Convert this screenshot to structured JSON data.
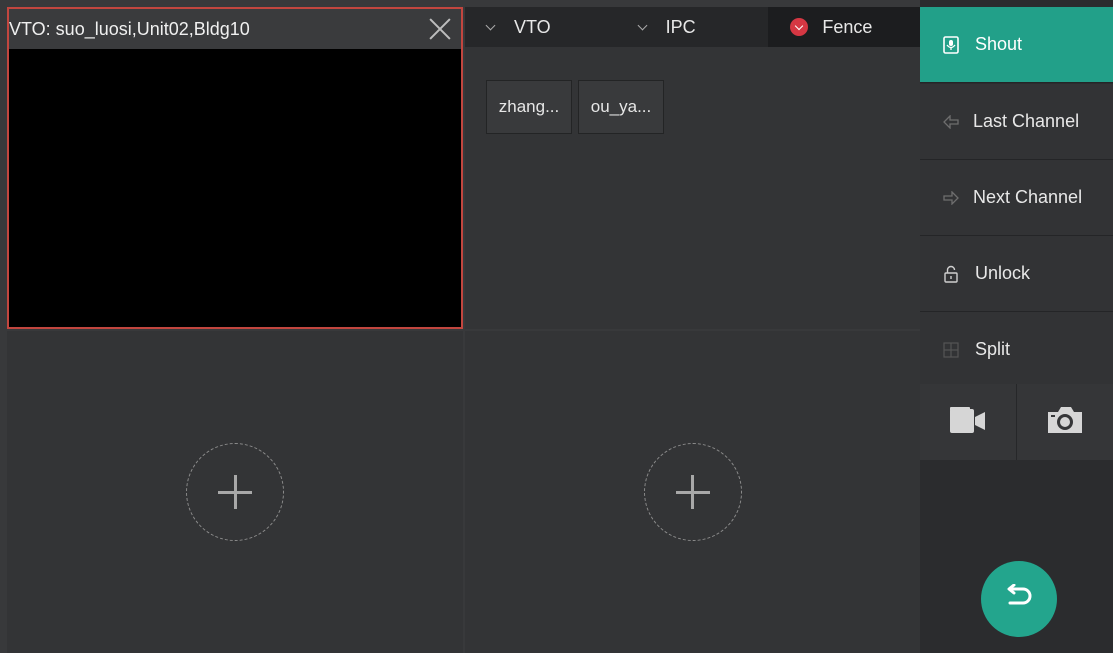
{
  "channel_cell": {
    "title": "VTO: suo_luosi,Unit02,Bldg10"
  },
  "tabs": [
    {
      "label": "VTO"
    },
    {
      "label": "IPC"
    },
    {
      "label": "Fence"
    }
  ],
  "devices": [
    {
      "label": "zhang..."
    },
    {
      "label": "ou_ya..."
    }
  ],
  "panel": {
    "shout": "Shout",
    "last_channel": "Last Channel",
    "next_channel": "Next Channel",
    "unlock": "Unlock",
    "split": "Split"
  },
  "colors": {
    "accent": "#22a089",
    "selected_border": "#c2463f",
    "fence_dot": "#d53743"
  },
  "icons": {
    "shout": "microphone-icon",
    "last": "arrow-left-icon",
    "next": "arrow-right-icon",
    "unlock": "lock-icon",
    "split": "grid-icon",
    "record": "video-camera-icon",
    "snapshot": "camera-icon",
    "back": "return-icon"
  }
}
